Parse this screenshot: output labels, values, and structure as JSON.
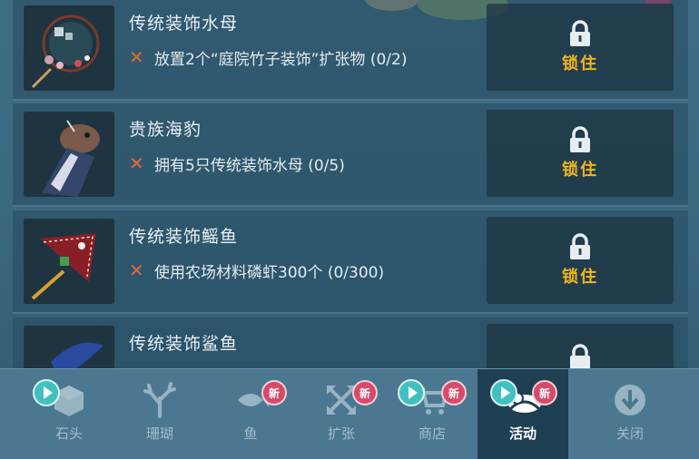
{
  "items": [
    {
      "title": "传统装饰水母",
      "task_text": "放置2个“庭院竹子装饰”扩张物 (0/2)",
      "status_label": "锁住"
    },
    {
      "title": "贵族海豹",
      "task_text": "拥有5只传统装饰水母 (0/5)",
      "status_label": "锁住"
    },
    {
      "title": "传统装饰鳐鱼",
      "task_text": "使用农场材料磷虾300个 (0/300)",
      "status_label": "锁住"
    },
    {
      "title": "传统装饰鲨鱼",
      "task_text": "",
      "status_label": ""
    }
  ],
  "tabs": [
    {
      "label": "石头",
      "icon": "cube-icon"
    },
    {
      "label": "珊瑚",
      "icon": "coral-icon"
    },
    {
      "label": "鱼",
      "icon": "fish-icon"
    },
    {
      "label": "扩张",
      "icon": "expand-icon"
    },
    {
      "label": "商店",
      "icon": "cart-icon"
    },
    {
      "label": "活动",
      "icon": "event-icon"
    },
    {
      "label": "关闭",
      "icon": "close-download-icon"
    }
  ],
  "badges": {
    "new": "新"
  },
  "active_tab": "活动",
  "colors": {
    "lock_label": "#f0b51e",
    "fail_mark": "#e0693a",
    "badge": "#d64a6a",
    "play": "#42c0c0"
  }
}
